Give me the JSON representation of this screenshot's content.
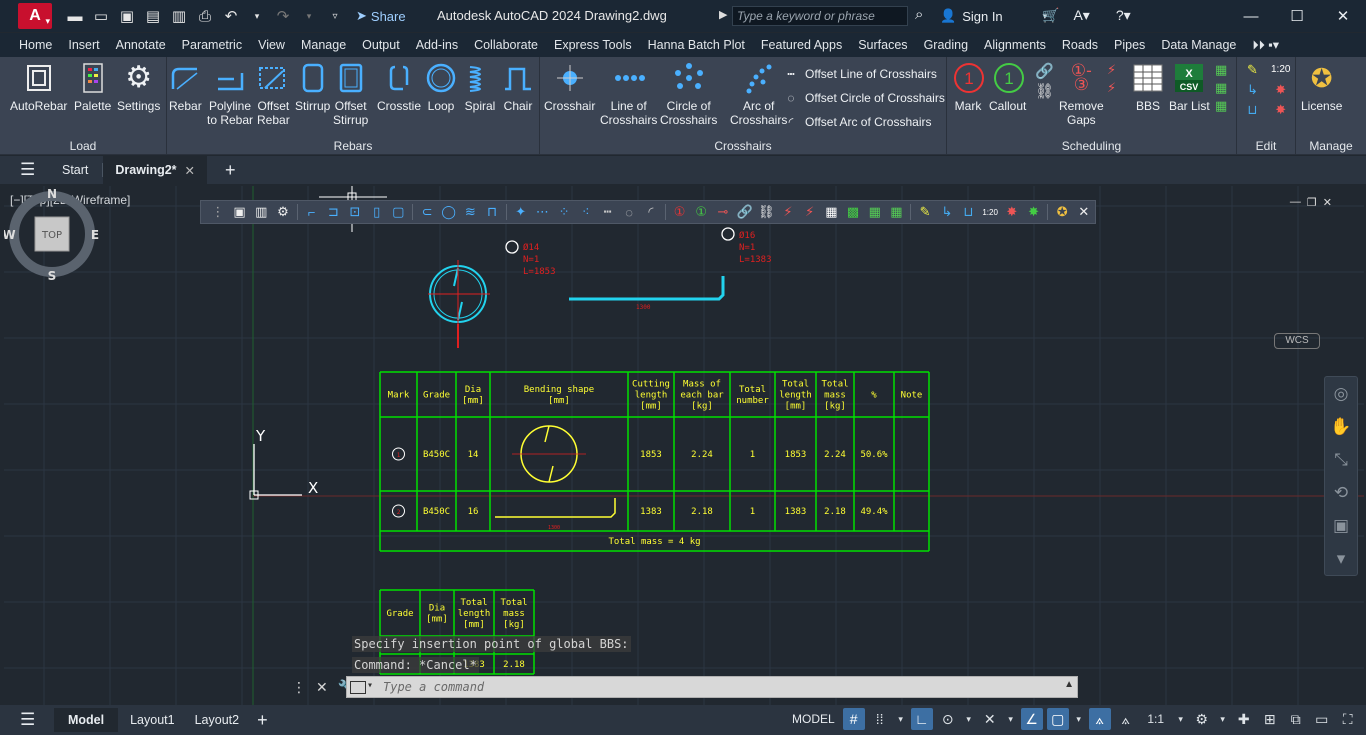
{
  "window": {
    "app_logo": "A",
    "title": "Autodesk AutoCAD 2024    Drawing2.dwg",
    "share_label": "Share",
    "search_placeholder": "Type a keyword or phrase",
    "signin_label": "Sign In"
  },
  "ribbon_tabs": [
    "Home",
    "Insert",
    "Annotate",
    "Parametric",
    "View",
    "Manage",
    "Output",
    "Add-ins",
    "Collaborate",
    "Express Tools",
    "Hanna Batch Plot",
    "Featured Apps",
    "Surfaces",
    "Grading",
    "Alignments",
    "Roads",
    "Pipes",
    "Data Manage"
  ],
  "ribbon": {
    "load": {
      "title": "Load",
      "tools": [
        "AutoRebar",
        "Palette",
        "Settings"
      ]
    },
    "rebars": {
      "title": "Rebars",
      "tools": [
        {
          "l1": "Rebar",
          "l2": ""
        },
        {
          "l1": "Polyline",
          "l2": "to Rebar"
        },
        {
          "l1": "Offset",
          "l2": "Rebar"
        },
        {
          "l1": "Stirrup",
          "l2": ""
        },
        {
          "l1": "Offset",
          "l2": "Stirrup"
        },
        {
          "l1": "Crosstie",
          "l2": ""
        },
        {
          "l1": "Loop",
          "l2": ""
        },
        {
          "l1": "Spiral",
          "l2": ""
        },
        {
          "l1": "Chair",
          "l2": ""
        }
      ]
    },
    "crosshairs": {
      "title": "Crosshairs",
      "tools": [
        {
          "l1": "Crosshair",
          "l2": ""
        },
        {
          "l1": "Line of",
          "l2": "Crosshairs"
        },
        {
          "l1": "Circle of",
          "l2": "Crosshairs"
        },
        {
          "l1": "Arc of",
          "l2": "Crosshairs"
        }
      ],
      "small": [
        "Offset Line of Crosshairs",
        "Offset Circle of Crosshairs",
        "Offset Arc of Crosshairs"
      ]
    },
    "scheduling": {
      "title": "Scheduling",
      "tools": [
        {
          "l1": "Mark",
          "l2": ""
        },
        {
          "l1": "Callout",
          "l2": ""
        },
        {
          "l1": "Remove",
          "l2": "Gaps"
        },
        {
          "l1": "BBS",
          "l2": ""
        },
        {
          "l1": "Bar List",
          "l2": ""
        }
      ]
    },
    "edit": {
      "title": "Edit"
    },
    "manage": {
      "title": "Manage",
      "tools": [
        "License"
      ]
    }
  },
  "doc_tabs": {
    "start": "Start",
    "active": "Drawing2*"
  },
  "viewport": {
    "label": "[−][Top][2D Wireframe]",
    "compass": {
      "n": "N",
      "s": "S",
      "e": "E",
      "w": "W",
      "top": "TOP"
    },
    "wcs": "WCS"
  },
  "drawing": {
    "mark1": {
      "dia": "Ø14",
      "n": "N=1",
      "l": "L=1853"
    },
    "mark2": {
      "dia": "Ø16",
      "n": "N=1",
      "l": "L=1383"
    },
    "bar2_dim": "1300",
    "bbs_headers": [
      "Mark",
      "Grade",
      "Dia\n[mm]",
      "Bending shape\n[mm]",
      "Cutting\nlength\n[mm]",
      "Mass of\neach bar\n[kg]",
      "Total\nnumber",
      "Total\nlength\n[mm]",
      "Total\nmass\n[kg]",
      "%",
      "Note"
    ],
    "bbs_rows": [
      [
        "1",
        "B450C",
        "14",
        "",
        "1853",
        "2.24",
        "1",
        "1853",
        "2.24",
        "50.6%",
        ""
      ],
      [
        "2",
        "B450C",
        "16",
        "",
        "1383",
        "2.18",
        "1",
        "1383",
        "2.18",
        "49.4%",
        ""
      ]
    ],
    "bbs_total": "Total mass = 4 kg",
    "summary_headers": [
      "Grade",
      "Dia\n[mm]",
      "Total\nlength\n[mm]",
      "Total\nmass\n[kg]"
    ],
    "summary_visible": [
      "1383",
      "2.18"
    ],
    "ucs": {
      "y": "Y",
      "x": "X"
    }
  },
  "command": {
    "history": [
      "Specify insertion point of global BBS:",
      "Command: *Cancel*"
    ],
    "placeholder": "Type a command"
  },
  "status": {
    "model_tab": "Model",
    "layouts": [
      "Layout1",
      "Layout2"
    ],
    "space": "MODEL",
    "scale": "1:1"
  },
  "colors": {
    "canvas_bg": "#212830",
    "table_green": "#00e000",
    "text_yellow": "#ffff33",
    "rebar_cyan": "#22d3ee",
    "mark_red": "#e02020"
  }
}
